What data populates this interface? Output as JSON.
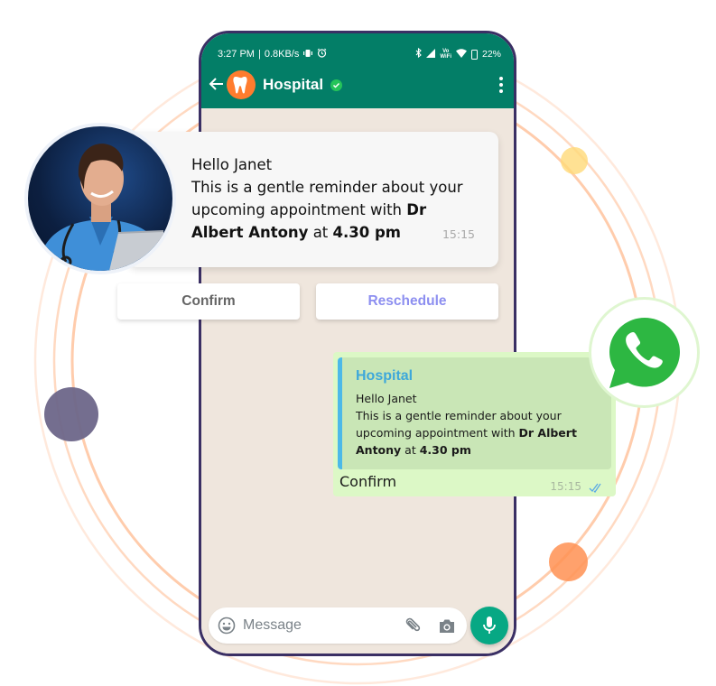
{
  "status_bar": {
    "time": "3:27 PM",
    "separator": "|",
    "speed": "0.8KB/s",
    "vowifi_top": "Vo",
    "vowifi_bottom": "WiFi",
    "battery": "22%"
  },
  "header": {
    "title": "Hospital",
    "avatar_icon": "tooth-icon",
    "verified_icon": "verified-check-icon",
    "menu_icon": "more-vertical-icon",
    "back_icon": "back-arrow-icon"
  },
  "incoming_message": {
    "greeting": "Hello Janet",
    "line1": "This is a gentle reminder about your upcoming appointment with ",
    "doctor": "Dr Albert Antony",
    "at": " at ",
    "time_of_appt": "4.30 pm",
    "timestamp": "15:15"
  },
  "quick_replies": {
    "confirm": "Confirm",
    "reschedule": "Reschedule"
  },
  "reply": {
    "quoted_sender": "Hospital",
    "quoted_greeting": "Hello Janet",
    "quoted_line1": "This is a gentle reminder about your upcoming appointment with ",
    "quoted_doctor": "Dr Albert Antony",
    "quoted_at": " at ",
    "quoted_time": "4.30 pm",
    "text": "Confirm",
    "timestamp": "15:15",
    "status": "read"
  },
  "composer": {
    "placeholder": "Message"
  },
  "colors": {
    "header_green": "#037e67",
    "chat_bg": "#efe6dd",
    "outgoing_bubble": "#dcf8c6",
    "quote_bar": "#4cb9e8",
    "mic_button": "#07a884",
    "avatar_orange": "#ff7c2e",
    "whatsapp_green": "#2db742",
    "ring_orange": "#ffc8a6",
    "reschedule_text": "#8d8ff0"
  }
}
